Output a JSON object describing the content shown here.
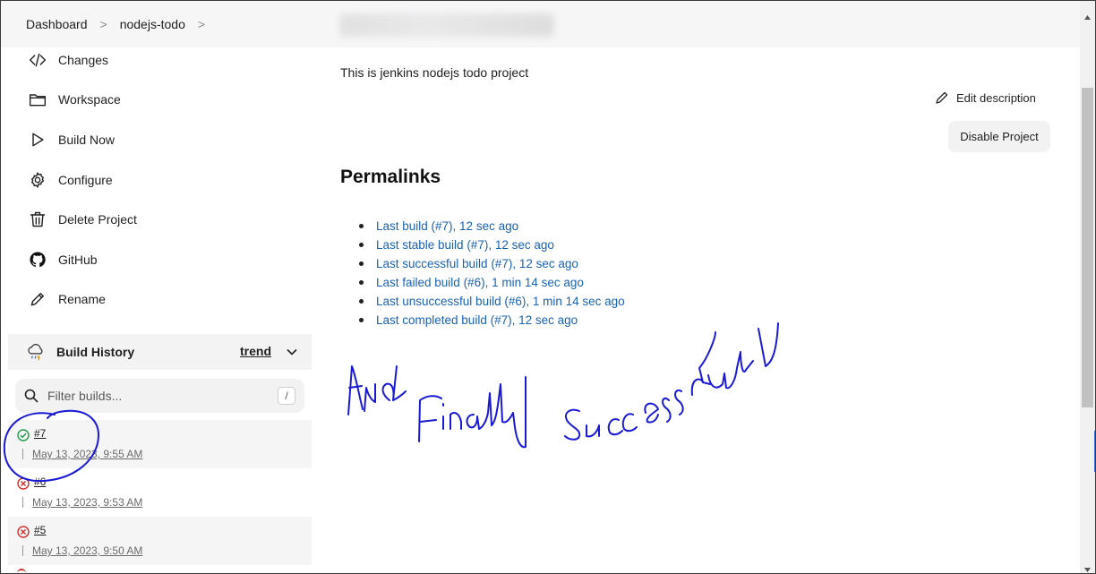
{
  "breadcrumb": {
    "items": [
      "Dashboard",
      "nodejs-todo"
    ],
    "separator": ">"
  },
  "sidebar": {
    "tasks": [
      {
        "label": "Changes",
        "icon": "code-icon"
      },
      {
        "label": "Workspace",
        "icon": "folder-icon"
      },
      {
        "label": "Build Now",
        "icon": "play-icon"
      },
      {
        "label": "Configure",
        "icon": "gear-icon"
      },
      {
        "label": "Delete Project",
        "icon": "trash-icon"
      },
      {
        "label": "GitHub",
        "icon": "github-icon"
      },
      {
        "label": "Rename",
        "icon": "pencil-icon"
      }
    ],
    "build_history": {
      "title": "Build History",
      "trend_label": "trend",
      "filter_placeholder": "Filter builds...",
      "filter_shortcut": "/",
      "builds": [
        {
          "number": "#7",
          "date": "May 13, 2023, 9:55 AM",
          "status": "success"
        },
        {
          "number": "#6",
          "date": "May 13, 2023, 9:53 AM",
          "status": "failed"
        },
        {
          "number": "#5",
          "date": "May 13, 2023, 9:50 AM",
          "status": "failed"
        }
      ]
    }
  },
  "main": {
    "description": "This is jenkins nodejs todo project",
    "edit_description_label": "Edit description",
    "disable_project_label": "Disable Project",
    "permalinks_title": "Permalinks",
    "permalinks": [
      "Last build (#7), 12 sec ago",
      "Last stable build (#7), 12 sec ago",
      "Last successful build (#7), 12 sec ago",
      "Last failed build (#6), 1 min 14 sec ago",
      "Last unsuccessful build (#6), 1 min 14 sec ago",
      "Last completed build (#7), 12 sec ago"
    ]
  },
  "annotation": {
    "handwritten_text": "And Finally successfull",
    "ink_color": "#1a1ad6"
  },
  "colors": {
    "link": "#1a62b3",
    "success": "#1e9b45",
    "failure": "#d32f2f"
  }
}
